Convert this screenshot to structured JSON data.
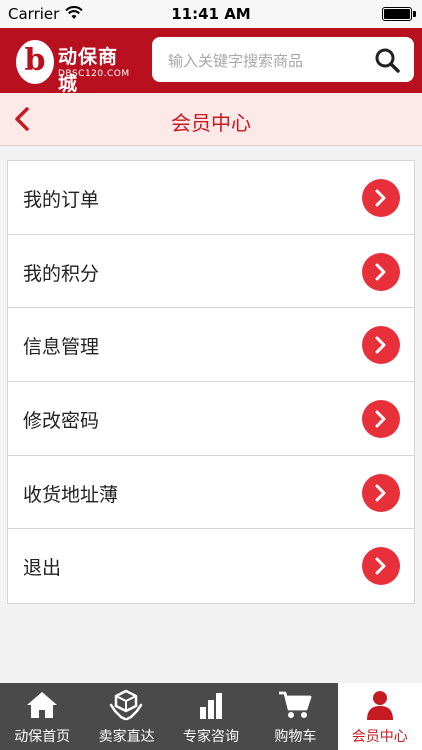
{
  "status_bar": {
    "carrier": "Carrier",
    "time": "11:41 AM"
  },
  "header": {
    "logo_brand": "动保商城",
    "logo_domain": "DBSC120.COM",
    "logo_letter": "b",
    "search_placeholder": "输入关键字搜索商品"
  },
  "subheader": {
    "title": "会员中心"
  },
  "menu": {
    "items": [
      {
        "label": "我的订单"
      },
      {
        "label": "我的积分"
      },
      {
        "label": "信息管理"
      },
      {
        "label": "修改密码"
      },
      {
        "label": "收货地址薄"
      },
      {
        "label": "退出"
      }
    ]
  },
  "tabbar": {
    "tabs": [
      {
        "label": "动保首页",
        "icon": "home-icon"
      },
      {
        "label": "卖家直达",
        "icon": "seller-icon"
      },
      {
        "label": "专家咨询",
        "icon": "bar-chart-icon"
      },
      {
        "label": "购物车",
        "icon": "cart-icon"
      },
      {
        "label": "会员中心",
        "icon": "user-icon"
      }
    ],
    "active": "会员中心"
  },
  "colors": {
    "brand_red": "#b8101f",
    "accent_red": "#e8303a",
    "subheader_bg": "#fde9e8",
    "tabbar_bg": "#4a4a4a"
  }
}
